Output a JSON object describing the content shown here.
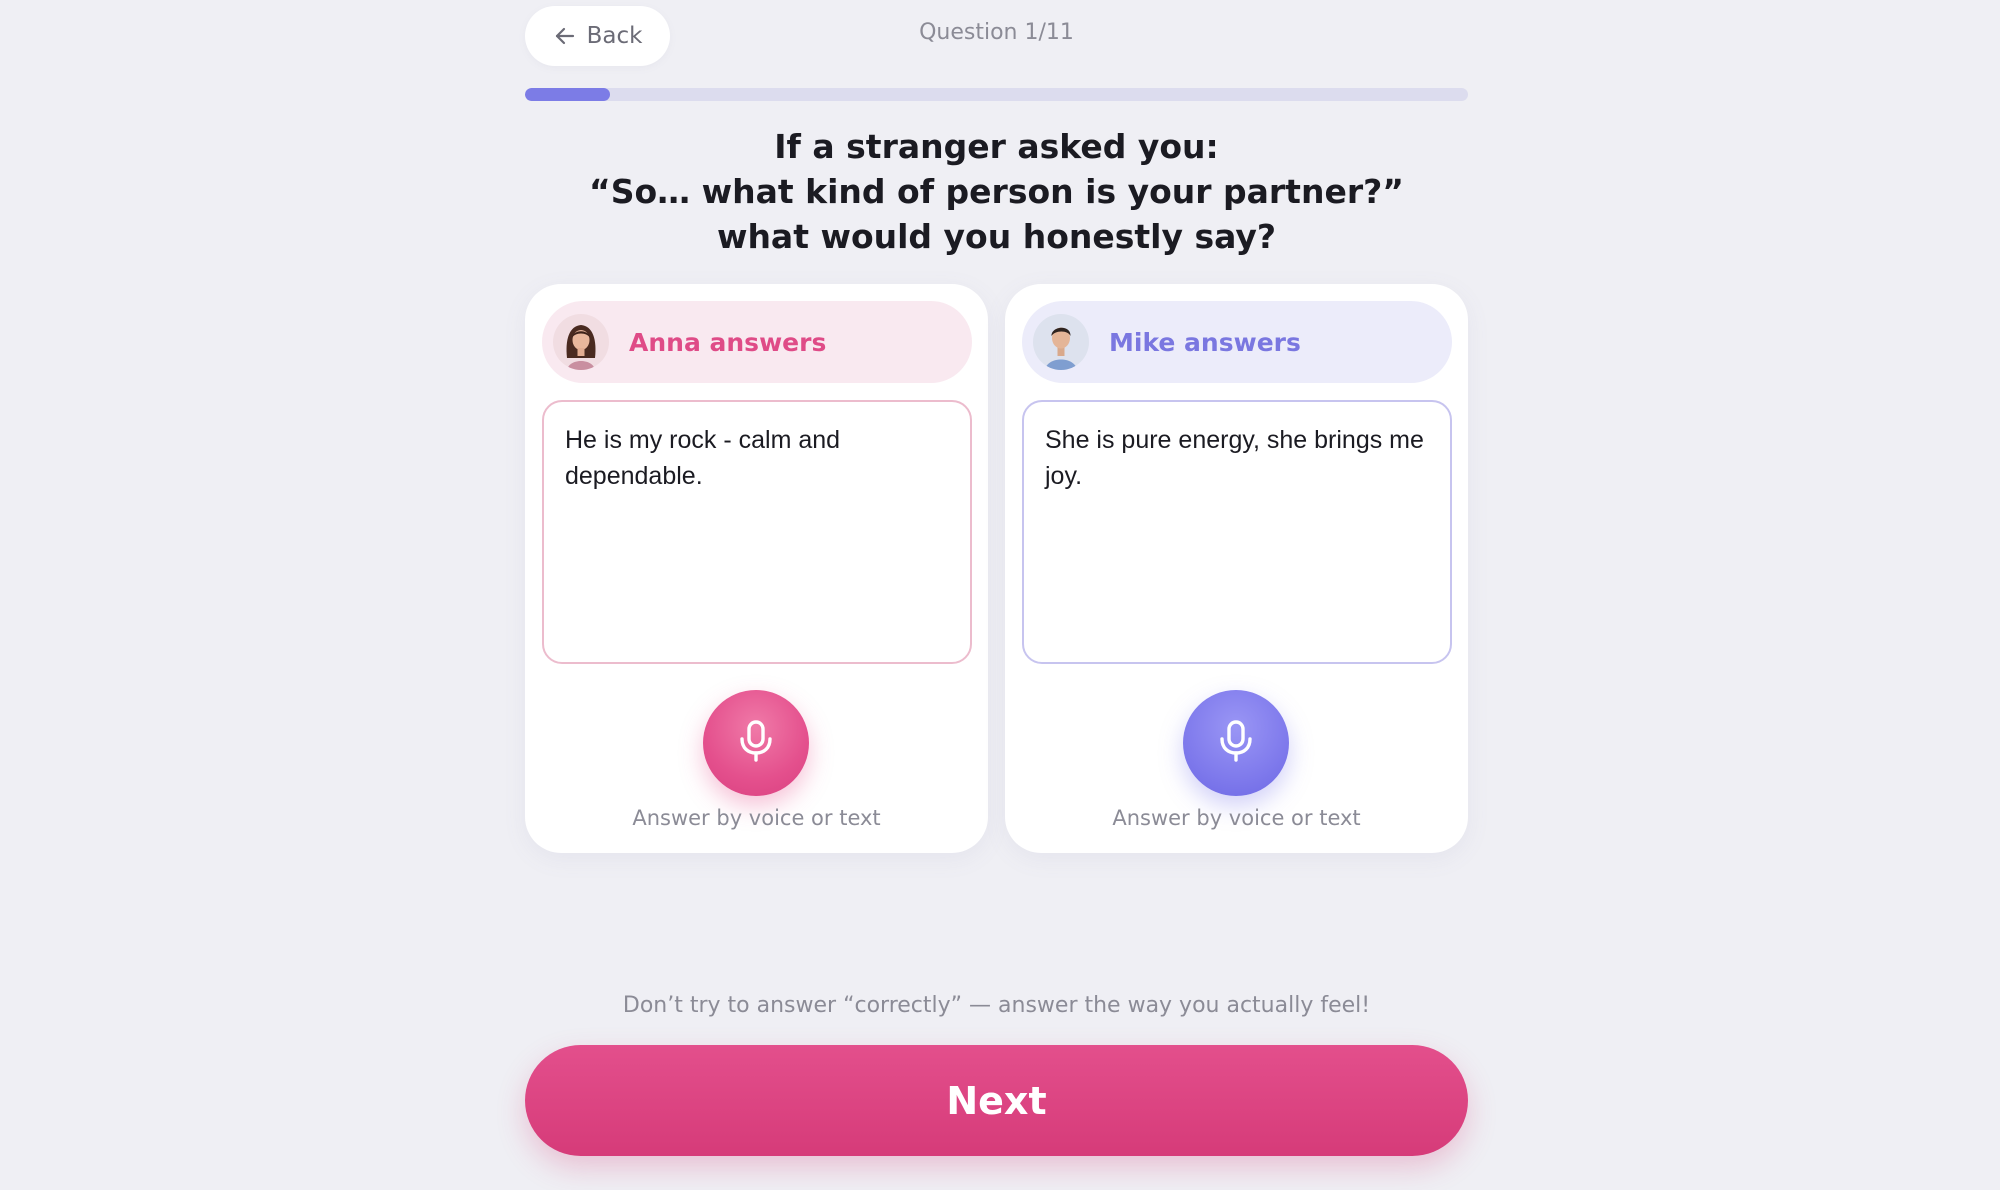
{
  "header": {
    "back_label": "Back",
    "question_counter": "Question 1/11",
    "progress_fraction": 0.09
  },
  "question": {
    "lines": [
      "If a stranger asked you:",
      "“So… what kind of person is your partner?”",
      "what would you honestly say?"
    ]
  },
  "cards": [
    {
      "title": "Anna answers",
      "answer": "He is my rock - calm and dependable.",
      "hint": "Answer by voice or text",
      "accent": "#df4b87"
    },
    {
      "title": "Mike answers",
      "answer": "She is pure energy, she brings me joy.",
      "hint": "Answer by voice or text",
      "accent": "#7a77e0"
    }
  ],
  "footer": {
    "tip": "Don’t try to answer “correctly” — answer the way you actually feel!",
    "next_label": "Next"
  },
  "icons": {
    "back": "arrow-left-icon",
    "mic": "microphone-icon"
  }
}
